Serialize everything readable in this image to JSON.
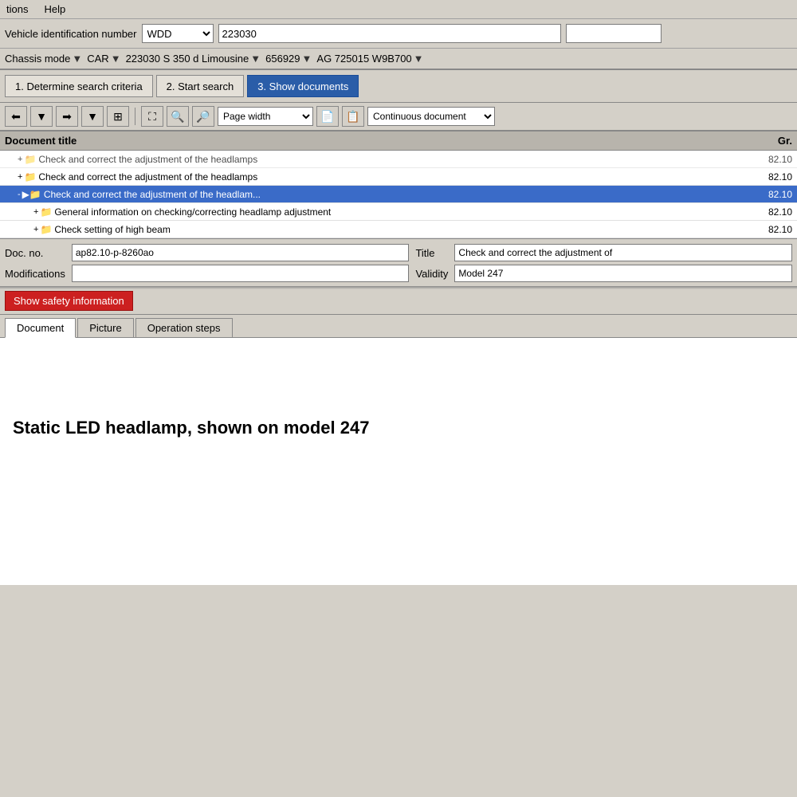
{
  "menubar": {
    "items": [
      "tions",
      "Help"
    ]
  },
  "vin": {
    "label": "Vehicle identification number",
    "prefix": "WDD",
    "number": "223030",
    "extra": ""
  },
  "chassis": {
    "mode_label": "Chassis mode",
    "car_label": "CAR",
    "model": "223030 S 350 d Limousine",
    "code1": "656929",
    "code2": "AG 725015 W9B700"
  },
  "steps": {
    "step1": "1. Determine search criteria",
    "step2": "2. Start search",
    "step3": "3. Show documents"
  },
  "toolbar": {
    "zoom_option": "Page width",
    "view_option": "Continuous document"
  },
  "document_list": {
    "header_title": "Document title",
    "header_gr": "Gr.",
    "rows": [
      {
        "indent": 2,
        "expand": "+",
        "text": "Check and correct the adjustment of the headlamps",
        "gr": "82.10",
        "selected": false,
        "partial": true
      },
      {
        "indent": 2,
        "expand": "+",
        "text": "Check and correct the adjustment of the headlamps",
        "gr": "82.10",
        "selected": false,
        "partial": false
      },
      {
        "indent": 2,
        "expand": "-",
        "text": "Check and correct the adjustment of the headlam...",
        "gr": "82.10",
        "selected": true,
        "partial": false
      },
      {
        "indent": 4,
        "expand": "+",
        "text": "General information on checking/correcting headlamp adjustment",
        "gr": "82.10",
        "selected": false,
        "partial": false
      },
      {
        "indent": 4,
        "expand": "+",
        "text": "Check setting of high beam",
        "gr": "82.10",
        "selected": false,
        "partial": false
      }
    ]
  },
  "doc_details": {
    "doc_no_label": "Doc. no.",
    "doc_no_value": "ap82.10-p-8260ao",
    "title_label": "Title",
    "title_value": "Check and correct the adjustment of",
    "modifications_label": "Modifications",
    "modifications_value": "",
    "validity_label": "Validity",
    "validity_value": "Model 247"
  },
  "safety": {
    "button_label": "Show safety information"
  },
  "tabs": {
    "items": [
      "Document",
      "Picture",
      "Operation steps"
    ],
    "active": 0
  },
  "content": {
    "heading": "Static LED headlamp, shown on model 247"
  }
}
